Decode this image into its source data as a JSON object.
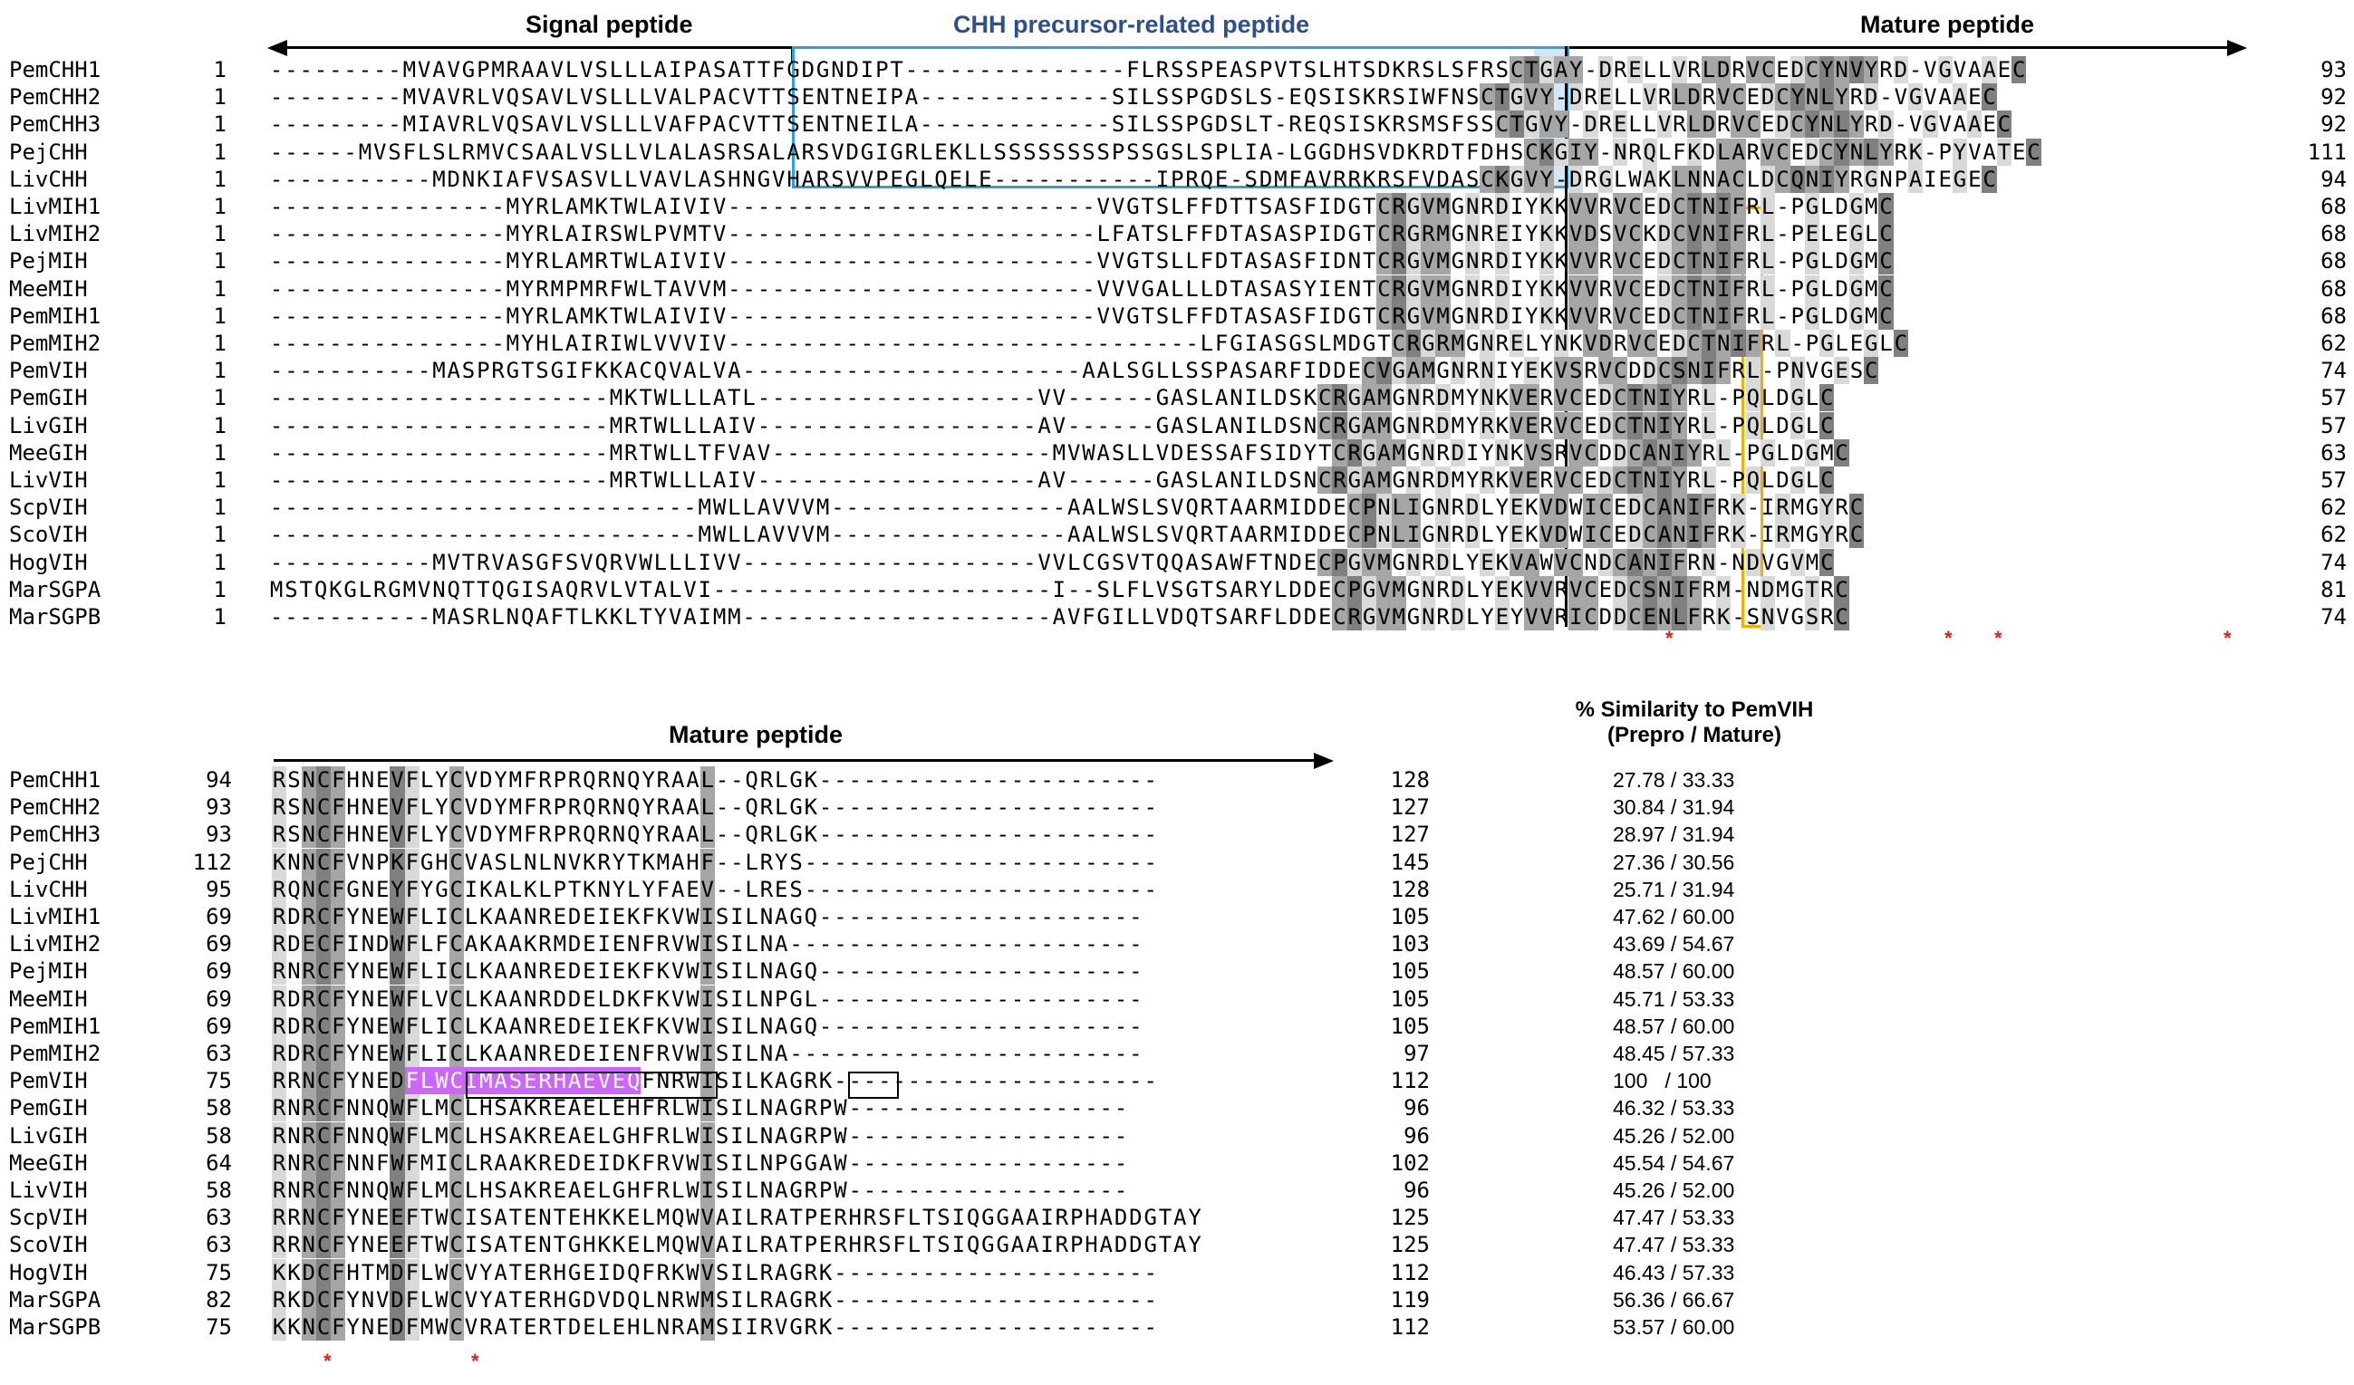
{
  "block1": {
    "headers": {
      "signal": "Signal peptide",
      "precursor": "CHH precursor-related peptide",
      "mature": "Mature peptide"
    },
    "rows": [
      {
        "name": "PemCHH1",
        "start": "1",
        "seq": "---------MVAVGPMRAAVLVSLLLAIPASATTFGDGNDIPT---------------FLRSSPEASPVTSLHTSDKRSLSFRSCTGAY-DRELLVRLDRVCEDCYNVYRD-VGVAAEC",
        "end": "93"
      },
      {
        "name": "PemCHH2",
        "start": "1",
        "seq": "---------MVAVRLVQSAVLVSLLLVALPACVTTSENTNEIPA-------------SILSSPGDSLS-EQSISKRSIWFNSCTGVY-DRELLVRLDRVCEDCYNLYRD-VGVAAEC",
        "end": "92"
      },
      {
        "name": "PemCHH3",
        "start": "1",
        "seq": "---------MIAVRLVQSAVLVSLLLVAFPACVTTSENTNEILA-------------SILSSPGDSLT-REQSISKRSMSFSSCTGVY-DRELLVRLDRVCEDCYNLYRD-VGVAAEC",
        "end": "92"
      },
      {
        "name": "PejCHH",
        "start": "1",
        "seq": "------MVSFLSLRMVCSAALVSLLVLALASRSALARSVDGIGRLEKLLSSSSSSSSPSSGSLSPLIA-LGGDHSVDKRDTFDHSCKGIY-NRQLFKDLARVCEDCYNLYRK-PYVATEC",
        "end": "111"
      },
      {
        "name": "LivCHH",
        "start": "1",
        "seq": "-----------MDNKIAFVSASVLLVAVLASHNGVHARSVVPEGLQELE-----------IPRQE-SDMFAVRRKRSFVDASCKGVY-DRGLWAKLNNACLDCQNIYRGNPAIEGEC",
        "end": "94"
      },
      {
        "name": "LivMIH1",
        "start": "1",
        "seq": "----------------MYRLAMKTWLAIVIV-------------------------VVGTSLFFDTTSASFIDGTCRGVMGNRDIYKKVVRVCEDCTNIFRL-PGLDGMC",
        "end": "68"
      },
      {
        "name": "LivMIH2",
        "start": "1",
        "seq": "----------------MYRLAIRSWLPVMTV-------------------------LFATSLFFDTASASPIDGTCRGRMGNREIYKKVDSVCKDCVNIFRL-PELEGLC",
        "end": "68"
      },
      {
        "name": "PejMIH",
        "start": "1",
        "seq": "----------------MYRLAMRTWLAIVIV-------------------------VVGTSLLFDTASASFIDNTCRGVMGNRDIYKKVVRVCEDCTNIFRL-PGLDGMC",
        "end": "68"
      },
      {
        "name": "MeeMIH",
        "start": "1",
        "seq": "----------------MYRMPMRFWLTAVVM-------------------------VVVGALLLDTASASYIENTCRGVMGNRDIYKKVVRVCEDCTNIFRL-PGLDGMC",
        "end": "68"
      },
      {
        "name": "PemMIH1",
        "start": "1",
        "seq": "----------------MYRLAMKTWLAIVIV-------------------------VVGTSLFFDTASASFIDGTCRGVMGNRDIYKKVVRVCEDCTNIFRL-PGLDGMC",
        "end": "68"
      },
      {
        "name": "PemMIH2",
        "start": "1",
        "seq": "----------------MYHLAIRIWLVVVIV--------------------------------LFGIASGSLMDGTCRGRMGNRELYNKVDRVCEDCTNIFRL-PGLEGLC",
        "end": "62"
      },
      {
        "name": "PemVIH",
        "start": "1",
        "seq": "-----------MASPRGTSGIFKKACQVALVA-----------------------AALSGLLSSPASARFIDDECVGAMGNRNIYEKVSRVCDDCSNIFRL-PNVGESC",
        "end": "74"
      },
      {
        "name": "PemGIH",
        "start": "1",
        "seq": "-----------------------MKTWLLLATL-------------------VV------GASLANILDSKCRGAMGNRDMYNKVERVCEDCTNIYRL-PQLDGLC",
        "end": "57"
      },
      {
        "name": "LivGIH",
        "start": "1",
        "seq": "-----------------------MRTWLLLAIV-------------------AV------GASLANILDSNCRGAMGNRDMYRKVERVCEDCTNIYRL-PQLDGLC",
        "end": "57"
      },
      {
        "name": "MeeGIH",
        "start": "1",
        "seq": "-----------------------MRTWLLTFVAV-------------------MVWASLLVDESSAFSIDYTCRGAMGNRDIYNKVSRVCDDCANIYRL-PGLDGMC",
        "end": "63"
      },
      {
        "name": "LivVIH",
        "start": "1",
        "seq": "-----------------------MRTWLLLAIV-------------------AV------GASLANILDSNCRGAMGNRDMYRKVERVCEDCTNIYRL-PQLDGLC",
        "end": "57"
      },
      {
        "name": "ScpVIH",
        "start": "1",
        "seq": "-----------------------------MWLLAVVVM----------------AALWSLSVQRTAARMIDDECPNLIGNRDLYEKVDWICEDCANIFRK-IRMGYRC",
        "end": "62"
      },
      {
        "name": "ScoVIH",
        "start": "1",
        "seq": "-----------------------------MWLLAVVVM----------------AALWSLSVQRTAARMIDDECPNLIGNRDLYEKVDWICEDCANIFRK-IRMGYRC",
        "end": "62"
      },
      {
        "name": "HogVIH",
        "start": "1",
        "seq": "-----------MVTRVASGFSVQRVWLLLIVV--------------------VVLCGSVTQQASAWFTNDECPGVMGNRDLYEKVAWVCNDCANIFRN-NDVGVMC",
        "end": "74"
      },
      {
        "name": "MarSGPA",
        "start": "1",
        "seq": "MSTQKGLRGMVNQTTQGISAQRVLVTALVI-----------------------I--SLFLVSGTSARYLDDECPGVMGNRDLYEKVVRVCEDCSNIFRM-NDMGTRC",
        "end": "81"
      },
      {
        "name": "MarSGPB",
        "start": "1",
        "seq": "-----------MASRLNQAFTLKKLTYVAIMM---------------------AVFGILLVDQTSARFLDDECRGVMGNRDLYEYVVRICDDCENLFRK-SNVGSRC",
        "end": "74"
      }
    ]
  },
  "block2": {
    "header": "Mature peptide",
    "rows": [
      {
        "name": "PemCHH1",
        "start": "94",
        "seq": "RSNCFHNEVFLYCVDYMFRPRQRNQYRAAL--QRLGK-----------------------",
        "end": "128"
      },
      {
        "name": "PemCHH2",
        "start": "93",
        "seq": "RSNCFHNEVFLYCVDYMFRPRQRNQYRAAL--QRLGK-----------------------",
        "end": "127"
      },
      {
        "name": "PemCHH3",
        "start": "93",
        "seq": "RSNCFHNEVFLYCVDYMFRPRQRNQYRAAL--QRLGK-----------------------",
        "end": "127"
      },
      {
        "name": "PejCHH",
        "start": "112",
        "seq": "KNNCFVNPKFGHCVASLNLNVKRYTKMAHF--LRYS------------------------",
        "end": "145"
      },
      {
        "name": "LivCHH",
        "start": "95",
        "seq": "RQNCFGNEYFYGCIKALKLPTKNYLYFAEV--LRES------------------------",
        "end": "128"
      },
      {
        "name": "LivMIH1",
        "start": "69",
        "seq": "RDRCFYNEWFLICLKAANREDEIEKFKVWISILNAGQ----------------------",
        "end": "105"
      },
      {
        "name": "LivMIH2",
        "start": "69",
        "seq": "RDECFINDWFLFCAKAAKRMDEIENFRVWISILNA------------------------",
        "end": "103"
      },
      {
        "name": "PejMIH",
        "start": "69",
        "seq": "RNRCFYNEWFLICLKAANREDEIEKFKVWISILNAGQ----------------------",
        "end": "105"
      },
      {
        "name": "MeeMIH",
        "start": "69",
        "seq": "RDRCFYNEWFLVCLKAANRDDELDKFKVWISILNPGL----------------------",
        "end": "105"
      },
      {
        "name": "PemMIH1",
        "start": "69",
        "seq": "RDRCFYNEWFLICLKAANREDEIEKFKVWISILNAGQ----------------------",
        "end": "105"
      },
      {
        "name": "PemMIH2",
        "start": "63",
        "seq": "RDRCFYNEWFLICLKAANREDEIENFRVWISILNA------------------------",
        "end": "97"
      },
      {
        "name": "PemVIH",
        "start": "75",
        "seq": "RRNCFYNEDFLWCIMASERHAEVEQFNRWISILKAGRK----------------------",
        "end": "112"
      },
      {
        "name": "PemGIH",
        "start": "58",
        "seq": "RNRCFNNQWFLMCLHSAKREAELEHFRLWISILNAGRPW-------------------",
        "end": "96"
      },
      {
        "name": "LivGIH",
        "start": "58",
        "seq": "RNRCFNNQWFLMCLHSAKREAELGHFRLWISILNAGRPW-------------------",
        "end": "96"
      },
      {
        "name": "MeeGIH",
        "start": "64",
        "seq": "RNRCFNNFWFMICLRAAKREDEIDKFRVWISILNPGGAW-------------------",
        "end": "102"
      },
      {
        "name": "LivVIH",
        "start": "58",
        "seq": "RNRCFNNQWFLMCLHSAKREAELGHFRLWISILNAGRPW-------------------",
        "end": "96"
      },
      {
        "name": "ScpVIH",
        "start": "63",
        "seq": "RRNCFYNEEFTWCISATENTEHKKELMQWVAILRATPERHRSFLTSIQGGAAIRPHADDGTAY",
        "end": "125"
      },
      {
        "name": "ScoVIH",
        "start": "63",
        "seq": "RRNCFYNEEFTWCISATENTGHKKELMQWVAILRATPERHRSFLTSIQGGAAIRPHADDGTAY",
        "end": "125"
      },
      {
        "name": "HogVIH",
        "start": "75",
        "seq": "KKDCFHTMDFLWCVYATERHGEIDQFRKWVSILRAGRK----------------------",
        "end": "112"
      },
      {
        "name": "MarSGPA",
        "start": "82",
        "seq": "RKDCFYNVDFLWCVYATERHGDVDQLNRWMSILRAGRK----------------------",
        "end": "119"
      },
      {
        "name": "MarSGPB",
        "start": "75",
        "seq": "KKNCFYNEDFMWCVRATERTDELEHLNRAMSIIRVGRK----------------------",
        "end": "112"
      }
    ],
    "similarity": {
      "header": "% Similarity to PemVIH\n(Prepro / Mature)",
      "values": [
        "27.78 / 33.33",
        "30.84 / 31.94",
        "28.97 / 31.94",
        "27.36 / 30.56",
        "25.71 / 31.94",
        "47.62 / 60.00",
        "43.69 / 54.67",
        "48.57 / 60.00",
        "45.71 / 53.33",
        "48.57 / 60.00",
        "48.45 / 57.33",
        "100   / 100",
        "46.32 / 53.33",
        "45.26 / 52.00",
        "45.54 / 54.67",
        "45.26 / 52.00",
        "47.47 / 53.33",
        "47.47 / 53.33",
        "46.43 / 57.33",
        "56.36 / 66.67",
        "53.57 / 60.00"
      ]
    }
  },
  "star_symbol": "*"
}
